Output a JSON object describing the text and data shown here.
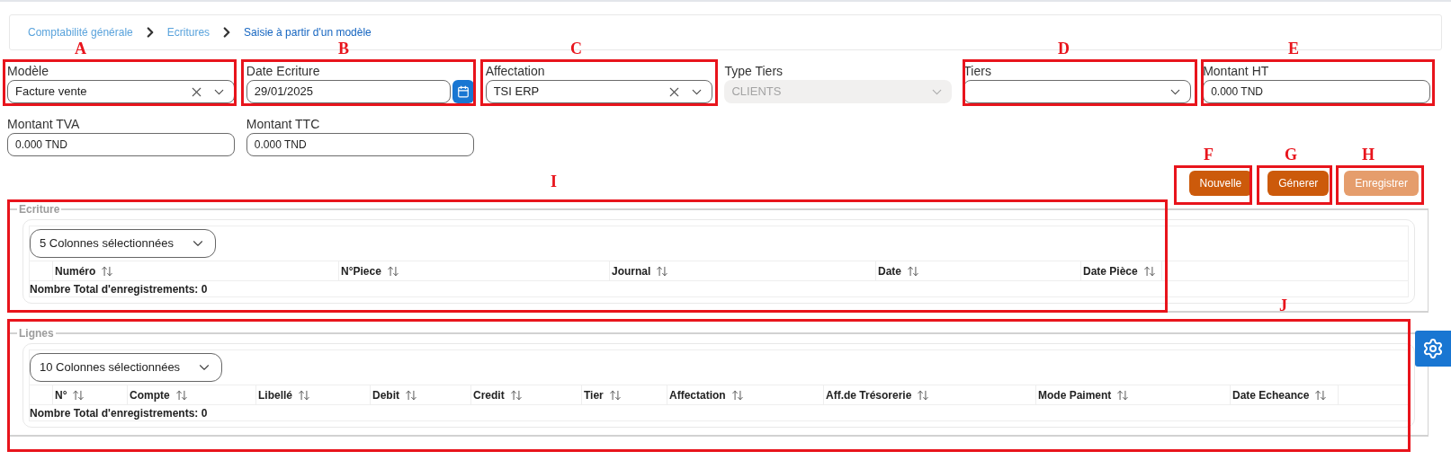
{
  "breadcrumb": [
    {
      "label": "Comptabilité générale",
      "current": false
    },
    {
      "label": "Ecritures",
      "current": false
    },
    {
      "label": "Saisie à partir d'un modèle",
      "current": true
    }
  ],
  "fields": [
    {
      "label": "Modèle",
      "kind": "select",
      "value": "Facture vente",
      "clearable": true,
      "disabled": false
    },
    {
      "label": "Date Ecriture",
      "kind": "date",
      "value": "29/01/2025"
    },
    {
      "label": "Affectation",
      "kind": "select",
      "value": "TSI ERP",
      "clearable": true,
      "disabled": false
    },
    {
      "label": "Type Tiers",
      "kind": "select",
      "value": "CLIENTS",
      "clearable": false,
      "disabled": true
    },
    {
      "label": "Tiers",
      "kind": "select",
      "clearable": false,
      "disabled": false
    },
    {
      "label": "Montant HT",
      "kind": "text",
      "value": "0.000 TND"
    },
    {
      "label": "Montant TVA",
      "kind": "text",
      "value": "0.000 TND"
    },
    {
      "label": "Montant TTC",
      "kind": "text",
      "value": "0.000 TND"
    }
  ],
  "buttons": [
    {
      "label": "Nouvelle",
      "disabled": false
    },
    {
      "label": "Génerer",
      "disabled": false
    },
    {
      "label": "Enregistrer",
      "disabled": true
    }
  ],
  "sections": [
    {
      "legend": "Ecriture",
      "column_picker": "5 Colonnes sélectionnées",
      "columns": [
        "Numéro",
        "N°Piece",
        "Journal",
        "Date",
        "Date Pièce"
      ],
      "total": "Nombre Total d'enregistrements: 0"
    },
    {
      "legend": "Lignes",
      "column_picker": "10 Colonnes sélectionnées",
      "columns": [
        "N°",
        "Compte",
        "Libellé",
        "Debit",
        "Credit",
        "Tier",
        "Affectation",
        "Aff.de Trésorerie",
        "Mode Paiment",
        "Date Echeance"
      ],
      "total": "Nombre Total d'enregistrements: 0"
    }
  ],
  "annotations": [
    {
      "letter": "A"
    },
    {
      "letter": "B"
    },
    {
      "letter": "C"
    },
    {
      "letter": "D"
    },
    {
      "letter": "E"
    },
    {
      "letter": "F"
    },
    {
      "letter": "G"
    },
    {
      "letter": "H"
    },
    {
      "letter": "I"
    },
    {
      "letter": "J"
    }
  ]
}
